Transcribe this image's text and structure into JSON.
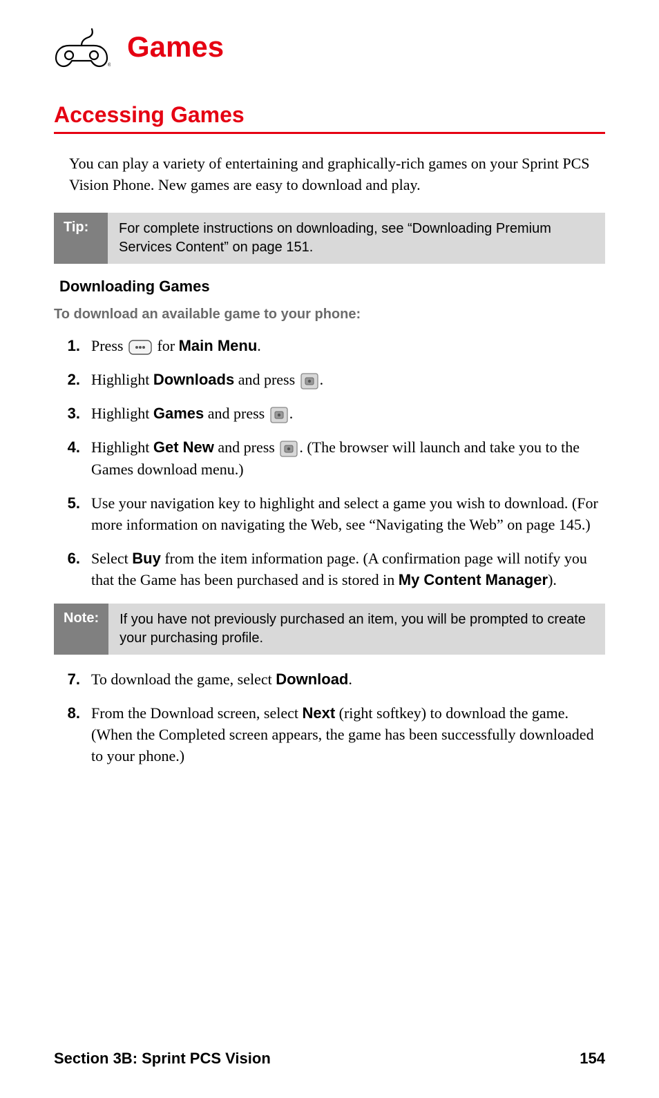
{
  "header": {
    "title": "Games"
  },
  "section": {
    "title": "Accessing Games"
  },
  "intro": "You can play a variety of entertaining and graphically-rich games on your Sprint PCS Vision Phone. New games are easy to download and play.",
  "tip": {
    "label": "Tip:",
    "body": "For complete instructions on downloading, see “Downloading Premium Services Content” on page 151."
  },
  "sub": {
    "heading": "Downloading Games",
    "lead": "To download an available game to your phone:"
  },
  "steps": {
    "s1": {
      "n": "1.",
      "a": "Press ",
      "b": " for ",
      "bold1": "Main Menu",
      "c": "."
    },
    "s2": {
      "n": "2.",
      "a": "Highlight ",
      "bold1": "Downloads",
      "b": " and press ",
      "c": "."
    },
    "s3": {
      "n": "3.",
      "a": "Highlight ",
      "bold1": "Games",
      "b": " and press ",
      "c": "."
    },
    "s4": {
      "n": "4.",
      "a": "Highlight ",
      "bold1": "Get New",
      "b": " and press ",
      "c": ". (The browser will launch and take you to the Games download menu.)"
    },
    "s5": {
      "n": "5.",
      "a": "Use your navigation key to highlight and select a game you wish to download. (For more information on navigating the Web, see “Navigating the Web” on page 145.)"
    },
    "s6": {
      "n": "6.",
      "a": "Select ",
      "bold1": "Buy",
      "b": " from the item information page. (A confirmation page will notify you that the Game has been purchased and is stored in ",
      "bold2": "My Content Manager",
      "c": ")."
    },
    "s7": {
      "n": "7.",
      "a": "To download the game, select ",
      "bold1": "Download",
      "b": "."
    },
    "s8": {
      "n": "8.",
      "a": "From the Download screen, select ",
      "bold1": "Next",
      "b": " (right softkey) to download the game. (When the Completed screen appears, the game has been successfully downloaded to your phone.)"
    }
  },
  "note": {
    "label": "Note:",
    "body": "If you have not previously purchased an item, you will be prompted to create your purchasing profile."
  },
  "footer": {
    "section": "Section 3B: Sprint PCS Vision",
    "page": "154"
  }
}
